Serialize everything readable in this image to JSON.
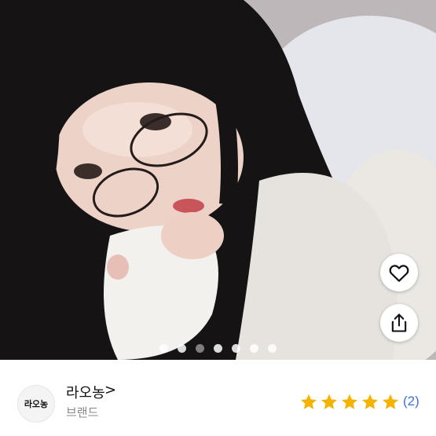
{
  "product_image": {
    "dots_total": 7,
    "active_dot": 2
  },
  "actions": {
    "like_icon": "heart-outline-icon",
    "share_icon": "share-icon"
  },
  "store": {
    "avatar_text": "라오농",
    "name": "라오농",
    "chevron": ">",
    "category": "브랜드"
  },
  "rating": {
    "stars": 5,
    "star_color": "#f5b301",
    "count_text": "(2)"
  },
  "colors": {
    "link": "#3d6fe0"
  }
}
